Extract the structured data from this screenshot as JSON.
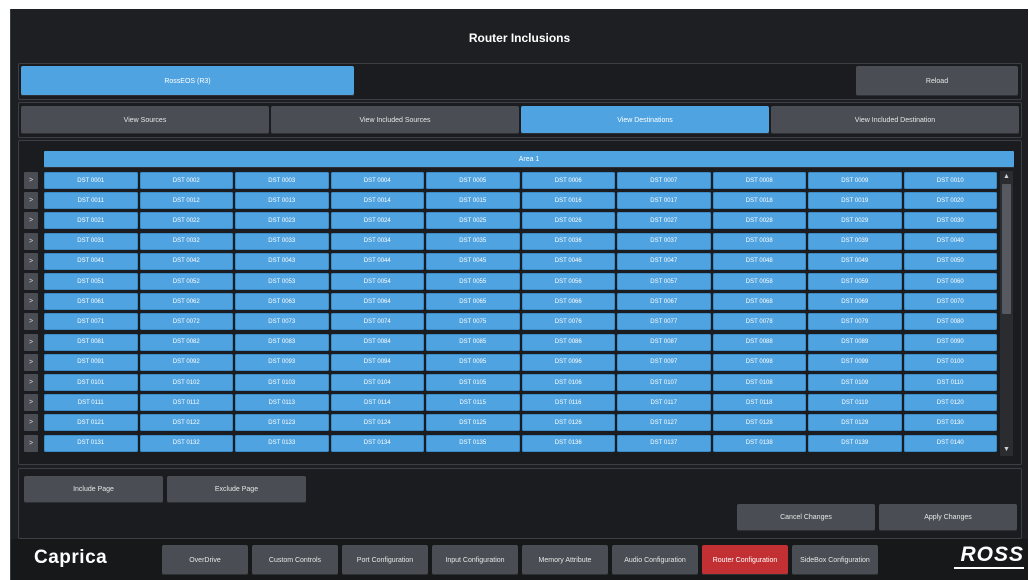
{
  "title": "Router Inclusions",
  "router": {
    "name": "RossEOS  (R3)",
    "reload_label": "Reload"
  },
  "tabs": [
    {
      "label": "View Sources",
      "active": false
    },
    {
      "label": "View Included Sources",
      "active": false
    },
    {
      "label": "View Destinations",
      "active": true
    },
    {
      "label": "View Included Destination",
      "active": false
    }
  ],
  "grid": {
    "area_label": "Area 1",
    "row_button_label": ">",
    "prefix": "DST",
    "rows": 14,
    "cols": 10,
    "scroll_up_icon": "triangle-up-icon",
    "scroll_down_icon": "triangle-down-icon",
    "scroll_up": "▲",
    "scroll_down": "▼"
  },
  "page_actions": {
    "include": "Include Page",
    "exclude": "Exclude Page"
  },
  "changes": {
    "cancel": "Cancel Changes",
    "apply": "Apply Changes"
  },
  "footer": {
    "logo": "Caprica",
    "brand": "ROSS",
    "nav": [
      {
        "label": "OverDrive",
        "active": false
      },
      {
        "label": "Custom Controls",
        "active": false
      },
      {
        "label": "Port Configuration",
        "active": false
      },
      {
        "label": "Input Configuration",
        "active": false
      },
      {
        "label": "Memory Attribute",
        "active": false
      },
      {
        "label": "Audio Configuration",
        "active": false
      },
      {
        "label": "Router Configuration",
        "active": true
      },
      {
        "label": "SideBox Configuration",
        "active": false
      }
    ]
  },
  "colors": {
    "accent": "#4fa3e0",
    "active_nav": "#c23034",
    "background": "#1d1f22"
  }
}
